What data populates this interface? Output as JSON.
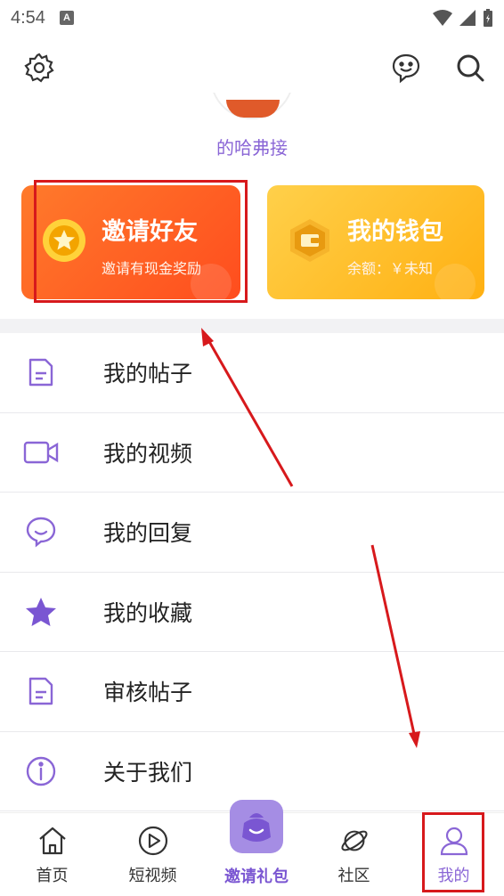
{
  "status_bar": {
    "time": "4:54",
    "notification_badge": "A"
  },
  "top_bar": {
    "left_icon": "gear-icon",
    "right_icons": [
      "chat-icon",
      "search-icon"
    ]
  },
  "profile": {
    "username": "的哈弗接"
  },
  "cards": {
    "invite": {
      "title": "邀请好友",
      "subtitle": "邀请有现金奖励",
      "icon": "star-coin-icon",
      "color_start": "#ff7a2b",
      "color_end": "#ff4d1e"
    },
    "wallet": {
      "title": "我的钱包",
      "subtitle": "余额：￥未知",
      "icon": "wallet-icon",
      "color_start": "#ffd04a",
      "color_end": "#ffb012"
    }
  },
  "menu": [
    {
      "label": "我的帖子",
      "icon": "document-icon"
    },
    {
      "label": "我的视频",
      "icon": "video-camera-icon"
    },
    {
      "label": "我的回复",
      "icon": "reply-bubble-icon"
    },
    {
      "label": "我的收藏",
      "icon": "star-icon"
    },
    {
      "label": "审核帖子",
      "icon": "review-document-icon"
    },
    {
      "label": "关于我们",
      "icon": "info-icon"
    }
  ],
  "tabbar": {
    "tabs": [
      {
        "label": "首页",
        "icon": "home-icon"
      },
      {
        "label": "短视频",
        "icon": "play-icon"
      },
      {
        "label": "邀请礼包",
        "icon": "gift-bag-icon"
      },
      {
        "label": "社区",
        "icon": "planet-icon"
      },
      {
        "label": "我的",
        "icon": "person-icon"
      }
    ],
    "active_index": 4
  },
  "colors": {
    "accent": "#8a66d6",
    "highlight": "#d7191c"
  }
}
